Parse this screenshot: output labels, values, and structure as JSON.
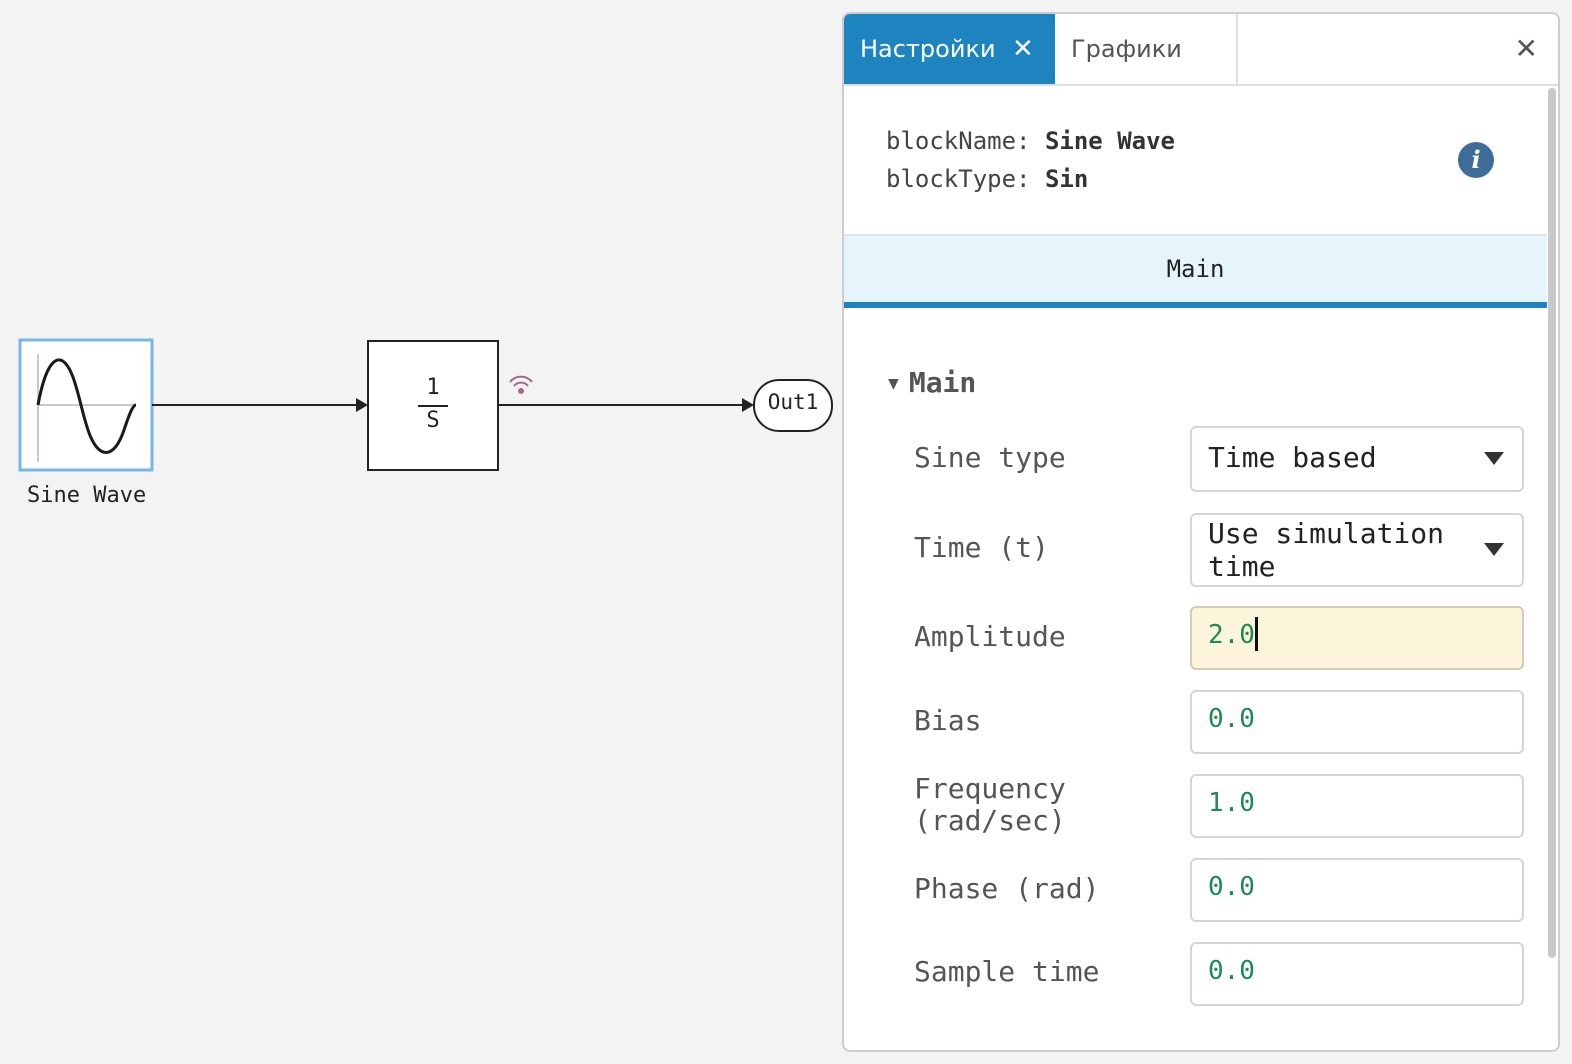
{
  "canvas": {
    "blocks": {
      "sine_wave": {
        "label": "Sine Wave"
      },
      "integrator": {
        "numerator": "1",
        "denominator": "S"
      },
      "out1": {
        "label": "Out1"
      }
    }
  },
  "panel": {
    "tabs": [
      {
        "label": "Настройки",
        "active": true
      },
      {
        "label": "Графики",
        "active": false
      }
    ],
    "tab_close_glyph": "✕",
    "close_glyph": "✕",
    "block_info": {
      "name_key": "blockName:",
      "name_value": "Sine Wave",
      "type_key": "blockType:",
      "type_value": "Sin"
    },
    "info_icon_glyph": "i",
    "section_tab": "Main",
    "group": {
      "title": "Main",
      "toggle_glyph": "▼",
      "params": [
        {
          "label": "Sine type",
          "kind": "select",
          "value": "Time based"
        },
        {
          "label": "Time (t)",
          "kind": "select",
          "value": "Use simulation time"
        },
        {
          "label": "Amplitude",
          "kind": "input",
          "value": "2.0",
          "focused": true
        },
        {
          "label": "Bias",
          "kind": "input",
          "value": "0.0"
        },
        {
          "label": "Frequency (rad/sec)",
          "kind": "input",
          "value": "1.0"
        },
        {
          "label": "Phase (rad)",
          "kind": "input",
          "value": "0.0"
        },
        {
          "label": "Sample time",
          "kind": "input",
          "value": "0.0"
        }
      ]
    }
  },
  "colors": {
    "accent": "#1d84c0",
    "section_bg": "#e6f4fb",
    "value_green": "#1c8a55",
    "focused_bg": "#fdf4dc",
    "info_icon": "#3e6e97",
    "canvas_bg": "#f3f3f3",
    "selected_block_border": "#7ab7e0"
  }
}
